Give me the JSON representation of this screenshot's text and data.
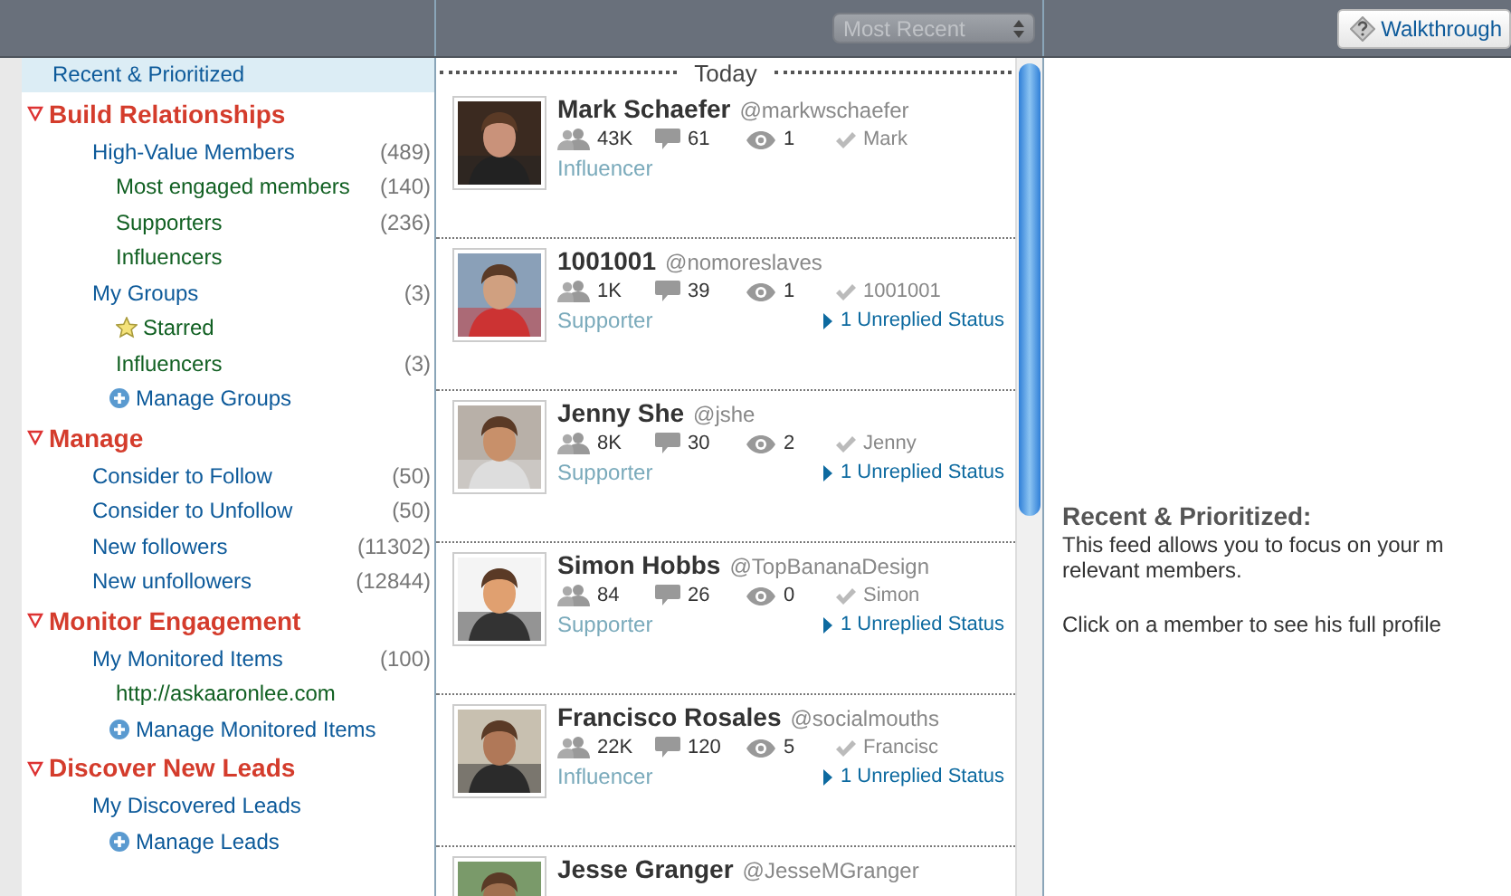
{
  "toolbar": {
    "sort": {
      "value": "Most Recent"
    },
    "help_button": "Walkthrough"
  },
  "sidebar": {
    "top": {
      "label": "Recent & Prioritized",
      "selected": true
    },
    "sections": [
      {
        "title": "Build Relationships",
        "expanded": true,
        "items": [
          {
            "label": "High-Value Members",
            "count": "(489)",
            "kind": "link",
            "children": [
              {
                "label": "Most engaged members",
                "count": "(140)",
                "kind": "link"
              },
              {
                "label": "Supporters",
                "count": "(236)",
                "kind": "link"
              },
              {
                "label": "Influencers",
                "kind": "link"
              }
            ]
          },
          {
            "label": "My Groups",
            "count": "(3)",
            "kind": "link",
            "children": [
              {
                "label": "Starred",
                "kind": "starred"
              },
              {
                "label": "Influencers",
                "count": "(3)",
                "kind": "link"
              },
              {
                "label": "Manage Groups",
                "kind": "manage"
              }
            ]
          }
        ]
      },
      {
        "title": "Manage",
        "expanded": true,
        "items": [
          {
            "label": "Consider to Follow",
            "count": "(50)",
            "kind": "link"
          },
          {
            "label": "Consider to Unfollow",
            "count": "(50)",
            "kind": "link"
          },
          {
            "label": "New followers",
            "count": "(11302)",
            "kind": "link"
          },
          {
            "label": "New unfollowers",
            "count": "(12844)",
            "kind": "link"
          }
        ]
      },
      {
        "title": "Monitor Engagement",
        "expanded": true,
        "items": [
          {
            "label": "My Monitored Items",
            "count": "(100)",
            "kind": "link",
            "children": [
              {
                "label": "http://askaaronlee.com",
                "kind": "link"
              },
              {
                "label": "Manage Monitored Items",
                "kind": "manage"
              }
            ]
          }
        ]
      },
      {
        "title": "Discover New Leads",
        "expanded": true,
        "items": [
          {
            "label": "My Discovered Leads",
            "kind": "link",
            "children": [
              {
                "label": "Manage Leads",
                "kind": "manage"
              }
            ]
          }
        ]
      }
    ]
  },
  "feed": {
    "day": "Today",
    "members": [
      {
        "name": "Mark Schaefer",
        "handle": "@markwschaefer",
        "followers": "43K",
        "replies": "61",
        "views": "1",
        "owner": "Mark",
        "tag": "Influencer"
      },
      {
        "name": "1001001",
        "handle": "@nomoreslaves",
        "followers": "1K",
        "replies": "39",
        "views": "1",
        "owner": "1001001",
        "tag": "Supporter",
        "unreplied": "1 Unreplied Status"
      },
      {
        "name": "Jenny She",
        "handle": "@jshe",
        "followers": "8K",
        "replies": "30",
        "views": "2",
        "owner": "Jenny",
        "tag": "Supporter",
        "unreplied": "1 Unreplied Status"
      },
      {
        "name": "Simon Hobbs",
        "handle": "@TopBananaDesign",
        "followers": "84",
        "replies": "26",
        "views": "0",
        "owner": "Simon",
        "tag": "Supporter",
        "unreplied": "1 Unreplied Status"
      },
      {
        "name": "Francisco Rosales",
        "handle": "@socialmouths",
        "followers": "22K",
        "replies": "120",
        "views": "5",
        "owner": "Francisc",
        "tag": "Influencer",
        "unreplied": "1 Unreplied Status"
      },
      {
        "name": "Jesse Granger",
        "handle": "@JesseMGranger"
      }
    ]
  },
  "info": {
    "title": "Recent & Prioritized:",
    "paragraphs": [
      "This feed allows you to focus on your m",
      "relevant members.",
      "Click on a member to see his full profile"
    ]
  }
}
